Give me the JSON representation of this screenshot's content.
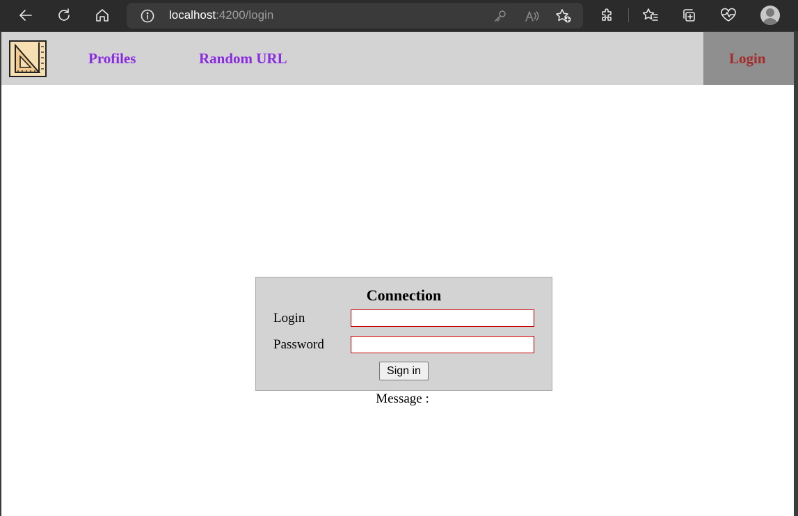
{
  "browser": {
    "url_host": "localhost",
    "url_path": ":4200/login",
    "icons": [
      "back-icon",
      "refresh-icon",
      "home-icon",
      "info-icon",
      "key-icon",
      "read-aloud-icon",
      "add-favorite-icon",
      "extensions-icon",
      "favorites-icon",
      "collections-icon",
      "health-icon",
      "profile-icon"
    ]
  },
  "nav": {
    "links": [
      {
        "label": "Profiles"
      },
      {
        "label": "Random URL"
      }
    ],
    "login_label": "Login",
    "colors": {
      "link": "#8a2be2",
      "login": "#a52a2a",
      "bar": "#d3d3d3",
      "login_cell": "#8f8f8f"
    }
  },
  "login_form": {
    "title": "Connection",
    "login_label": "Login",
    "login_value": "",
    "password_label": "Password",
    "password_value": "",
    "submit_label": "Sign in",
    "field_border_color": "#cc0000"
  },
  "message": {
    "label": "Message :",
    "value": ""
  }
}
